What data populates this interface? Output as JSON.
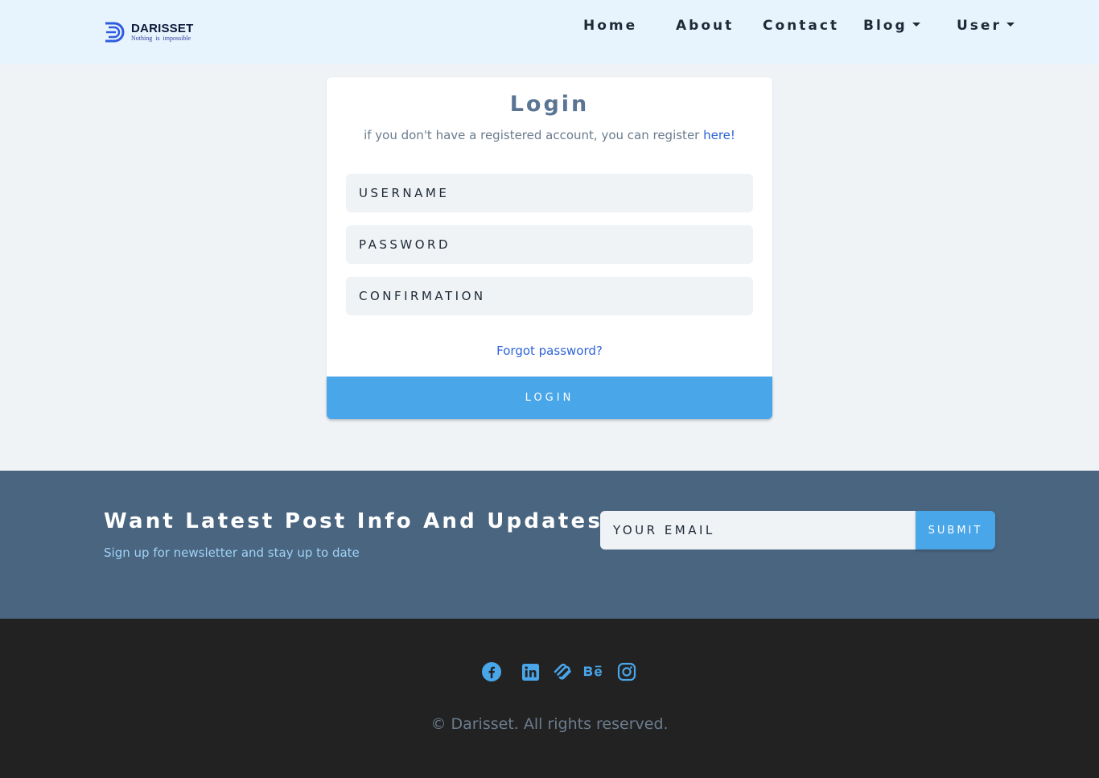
{
  "brand": {
    "name": "DARISSET",
    "tagline": "Nothing is impossible",
    "logo_color": "#2f5be0"
  },
  "nav": {
    "items": [
      {
        "label": "Home"
      },
      {
        "label": "About"
      },
      {
        "label": "Contact"
      },
      {
        "label": "Blog",
        "dropdown": true
      },
      {
        "label": "User",
        "dropdown": true
      }
    ]
  },
  "login": {
    "title": "Login",
    "subtitle": "if you don't have a registered account, you can register ",
    "register_link": "here!",
    "username_placeholder": "USERNAME",
    "password_placeholder": "PASSWORD",
    "confirmation_placeholder": "CONFIRMATION",
    "forgot_link": "Forgot password?",
    "button_label": "LOGIN"
  },
  "newsletter": {
    "title": "Want Latest Post Info And Updates?",
    "subtitle": "Sign up for newsletter and stay up to date",
    "email_placeholder": "YOUR EMAIL",
    "submit_label": "SUBMIT"
  },
  "footer": {
    "social_icons": [
      "facebook-icon",
      "linkedin-icon",
      "squarespace-icon",
      "behance-icon",
      "instagram-icon"
    ],
    "copyright": "© Darisset. All rights reserved."
  },
  "colors": {
    "navbar_bg": "#e8f4fd",
    "page_bg": "#eff3f6",
    "accent_blue": "#49a6e9",
    "link_blue": "#2e63d8",
    "newsletter_bg": "#4a6580",
    "footer_bg": "#222222"
  }
}
